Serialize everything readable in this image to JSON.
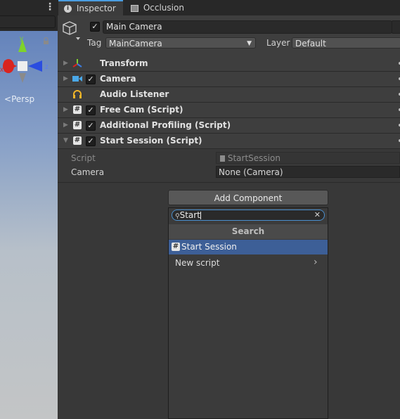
{
  "inspector_tab": {
    "label": "Inspector"
  },
  "occlusion_tab": {
    "label": "Occlusion"
  },
  "scene": {
    "persp_label": "Persp",
    "axis_x": "x",
    "axis_y": "y",
    "axis_z": "z"
  },
  "object": {
    "name": "Main Camera",
    "tag_label": "Tag",
    "tag_value": "MainCamera",
    "layer_label": "Layer",
    "layer_value": "Default"
  },
  "components": [
    {
      "label": "Transform",
      "icon": "transform-icon"
    },
    {
      "label": "Camera",
      "icon": "camera-icon"
    },
    {
      "label": "Audio Listener",
      "icon": "headphones-icon"
    },
    {
      "label": "Free Cam (Script)",
      "icon": "script-icon"
    },
    {
      "label": "Additional Profiling (Script)",
      "icon": "script-icon"
    },
    {
      "label": "Start Session (Script)",
      "icon": "script-icon"
    }
  ],
  "fields": {
    "script_label": "Script",
    "script_value": "StartSession",
    "camera_label": "Camera",
    "camera_value": "None (Camera)"
  },
  "add_component": {
    "button_label": "Add Component",
    "search_value": "Start",
    "header": "Search",
    "results": [
      {
        "label": "Start Session"
      },
      {
        "label": "New script"
      }
    ]
  },
  "colors": {
    "accent": "#4a9de0",
    "selected": "#3d5f97"
  }
}
